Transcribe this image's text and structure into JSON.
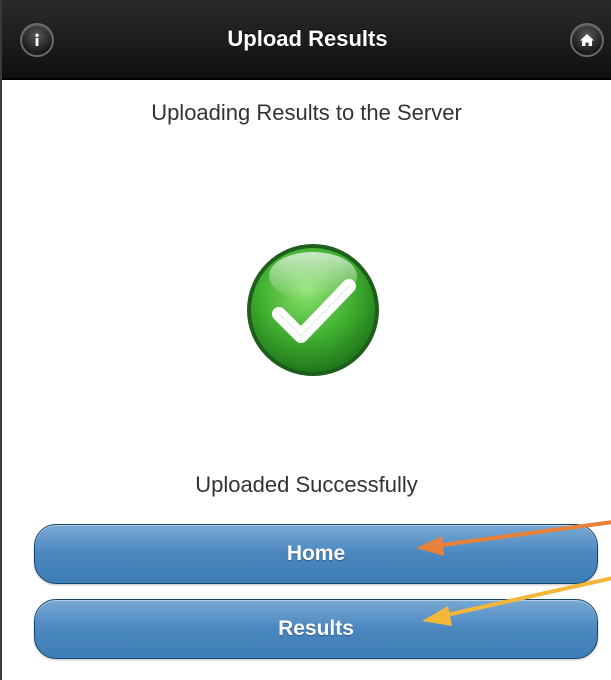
{
  "header": {
    "title": "Upload Results"
  },
  "main": {
    "heading": "Uploading Results to the Server",
    "status": "Uploaded Successfully"
  },
  "buttons": {
    "home": "Home",
    "results": "Results"
  },
  "colors": {
    "topbar": "#111111",
    "button_blue": "#4a87bf",
    "check_green": "#2f9e2f",
    "arrow_orange": "#e8823a",
    "arrow_yellow": "#f4b73a"
  }
}
